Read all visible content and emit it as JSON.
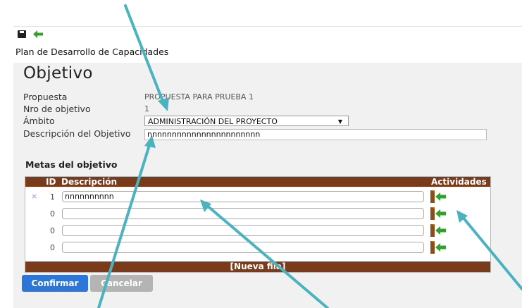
{
  "toolbar": {
    "save_icon": "floppy-disk-icon",
    "back_icon": "green-back-arrow-icon"
  },
  "module_title": "Plan de Desarrollo de Capacidades",
  "page_title": "Objetivo",
  "form": {
    "propuesta_label": "Propuesta",
    "propuesta_value": "PROPUESTA PARA PRUEBA 1",
    "nro_label": "Nro de objetivo",
    "nro_value": "1",
    "ambito_label": "Ámbito",
    "ambito_value": "ADMINISTRACIÓN DEL PROYECTO",
    "descripcion_label": "Descripción del Objetivo",
    "descripcion_value": "nnnnnnnnnnnnnnnnnnnnnnn"
  },
  "metas": {
    "section_title": "Metas del objetivo",
    "headers": {
      "id": "ID",
      "descripcion": "Descripción",
      "actividades": "Actividades"
    },
    "rows": [
      {
        "id": "1",
        "descripcion": "nnnnnnnnnn",
        "removable": true
      },
      {
        "id": "0",
        "descripcion": "",
        "removable": false
      },
      {
        "id": "0",
        "descripcion": "",
        "removable": false
      },
      {
        "id": "0",
        "descripcion": "",
        "removable": false
      }
    ],
    "remove_glyph": "×",
    "new_row_label": "[Nueva fila]"
  },
  "buttons": {
    "confirm": "Confirmar",
    "cancel": "Cancelar"
  },
  "colors": {
    "grid_header": "#7b3b1a",
    "confirm_button": "#2e75d8",
    "cancel_button": "#b4b4b4",
    "annotation_arrow": "#4bb3c0",
    "actividades_icon_green": "#33a02c",
    "actividades_icon_orange": "#c0772b"
  },
  "annotation": {
    "arrows_color": "#4bb3c0",
    "count": 5
  }
}
